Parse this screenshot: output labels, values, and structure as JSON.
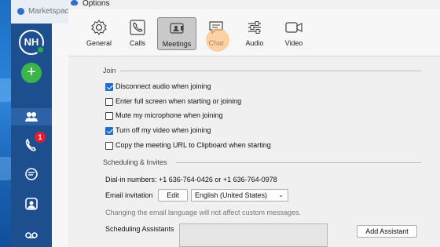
{
  "back_window": {
    "title": "Marketspace",
    "avatar_initials": "NH",
    "notification_count": "1",
    "icons": [
      "plus-icon",
      "contacts-icon",
      "phone-icon",
      "chat-icon",
      "meetings-icon",
      "voicemail-icon"
    ]
  },
  "dialog": {
    "title": "Options",
    "tabs": [
      {
        "label": "General",
        "icon": "gear-icon"
      },
      {
        "label": "Calls",
        "icon": "phone-icon"
      },
      {
        "label": "Meetings",
        "icon": "video-camera-icon",
        "selected": true
      },
      {
        "label": "Chat",
        "icon": "chat-icon"
      },
      {
        "label": "Audio",
        "icon": "sliders-icon"
      },
      {
        "label": "Video",
        "icon": "video-icon"
      }
    ],
    "join": {
      "heading": "Join",
      "options": [
        {
          "label": "Disconnect audio when joining",
          "checked": true
        },
        {
          "label": "Enter full screen when starting or joining",
          "checked": false
        },
        {
          "label": "Mute my microphone when joining",
          "checked": false
        },
        {
          "label": "Turn off my video when joining",
          "checked": true
        },
        {
          "label": "Copy the meeting URL to Clipboard when starting",
          "checked": false
        }
      ]
    },
    "scheduling": {
      "heading": "Scheduling & Invites",
      "dial_in": "Dial-in numbers: +1 636-764-0426 or +1 636-764-0978",
      "email_invitation_label": "Email invitation",
      "edit_label": "Edit",
      "language_value": "English (United States)",
      "language_note": "Changing the email language will not affect custom messages.",
      "assistants_label": "Scheduling Assistants",
      "add_assistant_label": "Add Assistant"
    }
  },
  "colors": {
    "accent": "#1f6fd1",
    "rail": "#1d4f8f",
    "add_button": "#3bb54a",
    "badge": "#e11d2e"
  }
}
